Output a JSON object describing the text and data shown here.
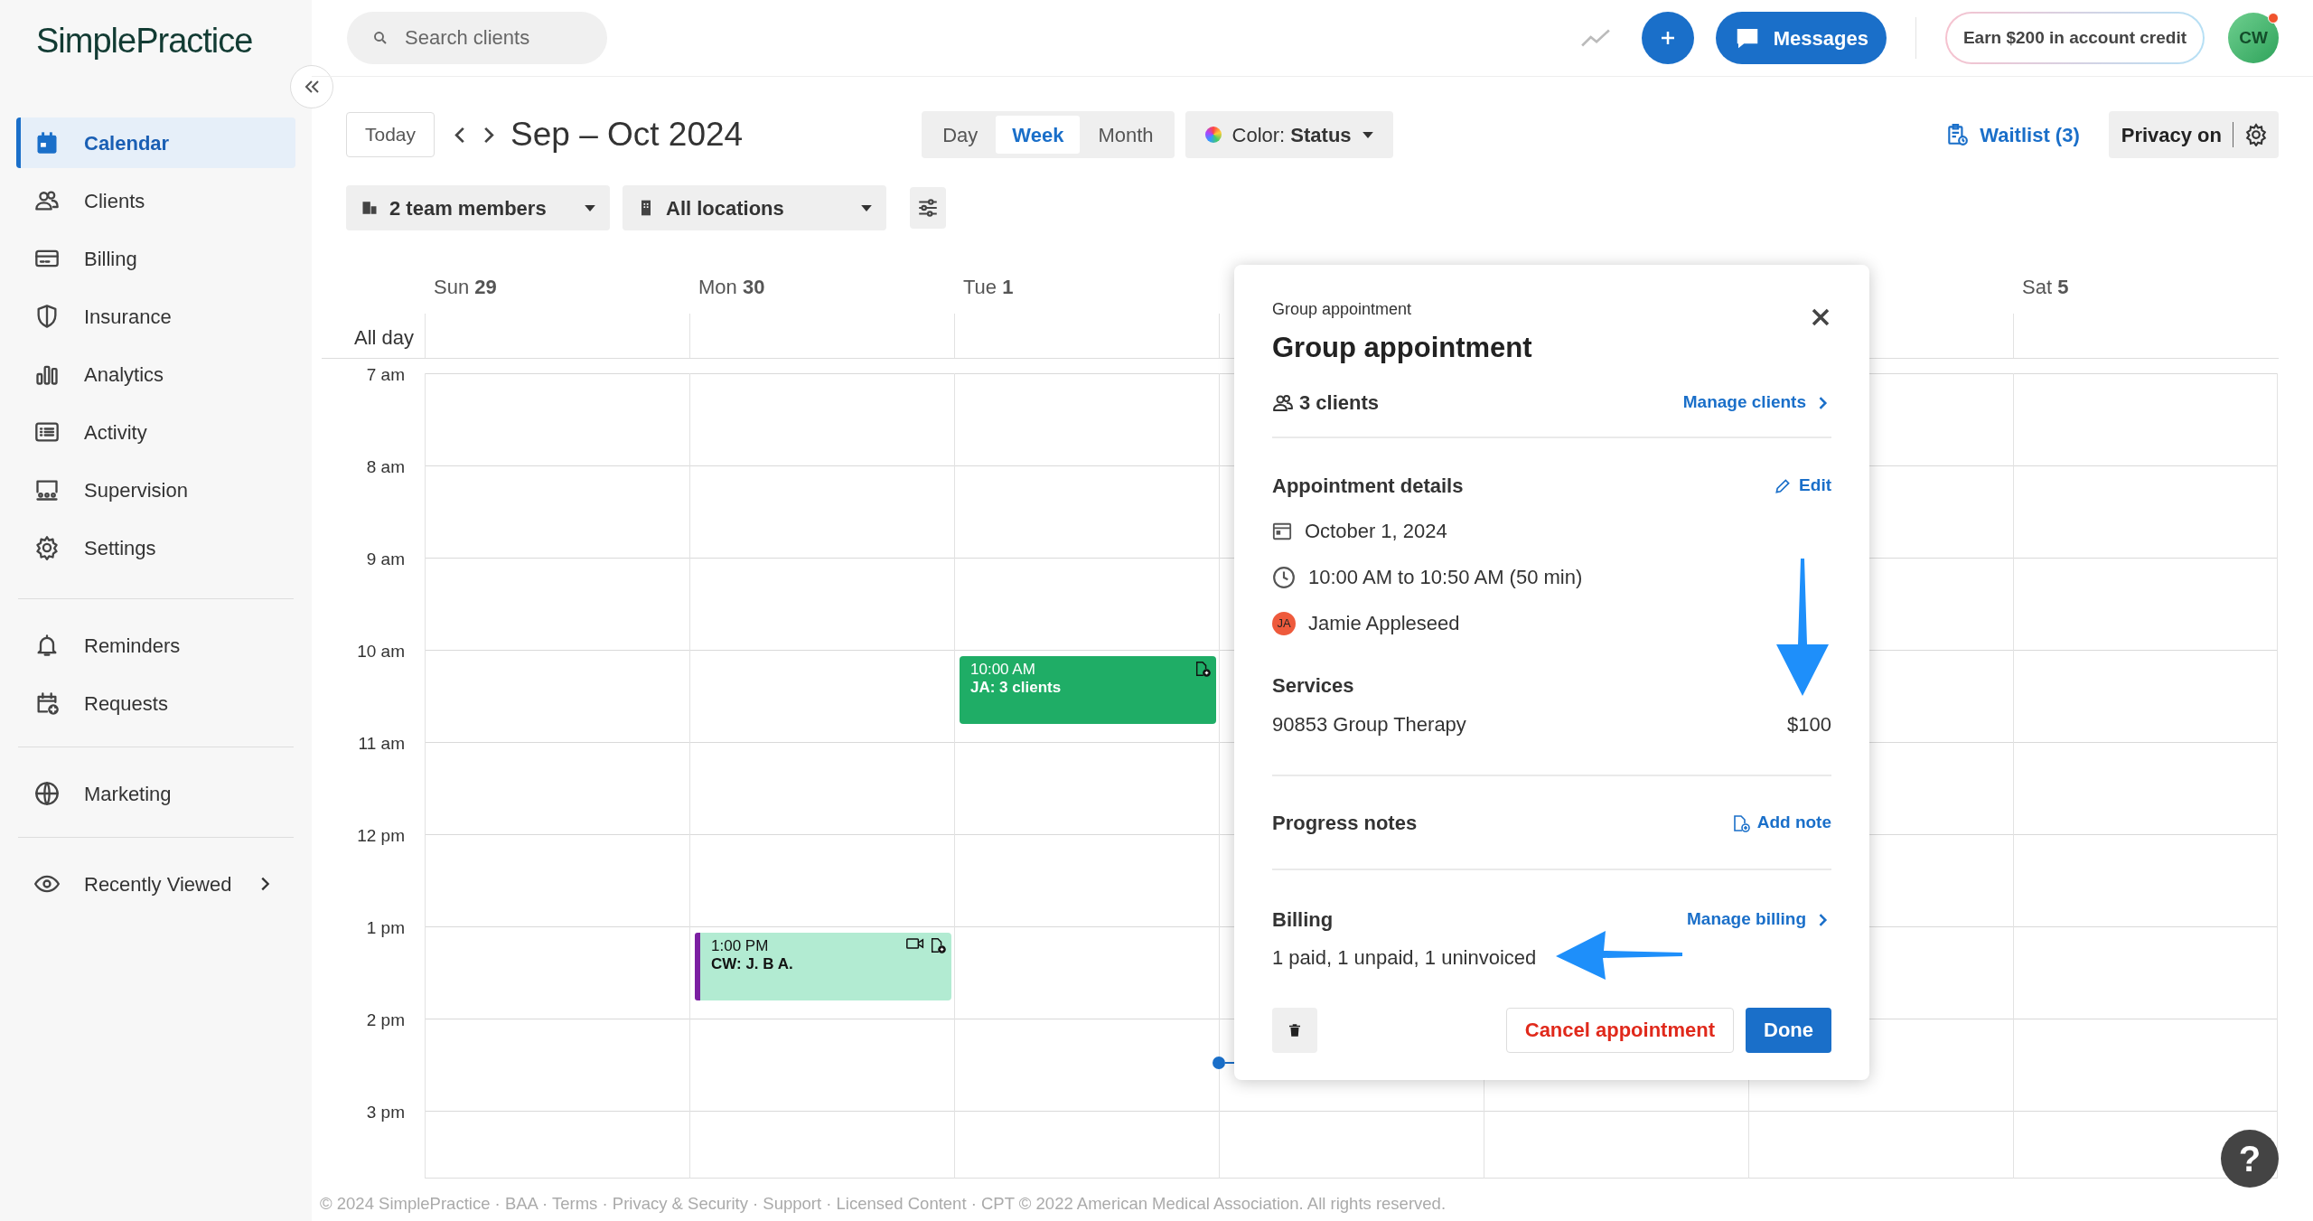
{
  "logo": {
    "text": "SimplePractice"
  },
  "sidebar": {
    "groups": [
      [
        {
          "label": "Calendar",
          "selected": true,
          "kind": "link"
        },
        {
          "label": "Clients",
          "selected": false,
          "kind": "link"
        },
        {
          "label": "Billing",
          "selected": false,
          "kind": "link"
        },
        {
          "label": "Insurance",
          "selected": false,
          "kind": "link"
        },
        {
          "label": "Analytics",
          "selected": false,
          "kind": "link"
        },
        {
          "label": "Activity",
          "selected": false,
          "kind": "link"
        },
        {
          "label": "Supervision",
          "selected": false,
          "kind": "link"
        },
        {
          "label": "Settings",
          "selected": false,
          "kind": "link"
        }
      ],
      [
        {
          "label": "Reminders",
          "selected": false,
          "kind": "link"
        },
        {
          "label": "Requests",
          "selected": false,
          "kind": "link"
        }
      ],
      [
        {
          "label": "Marketing",
          "selected": false,
          "kind": "link"
        }
      ],
      [
        {
          "label": "Recently Viewed",
          "selected": false,
          "kind": "submenu"
        }
      ]
    ]
  },
  "topbar": {
    "search": {
      "placeholder": "Search clients"
    },
    "messages_button": "Messages",
    "credit_button": "Earn $200 in account credit",
    "avatar": {
      "initials": "CW",
      "notification": true
    }
  },
  "toolbar": {
    "today": "Today",
    "range_title": "Sep – Oct 2024",
    "views": [
      {
        "label": "Day",
        "selected": false
      },
      {
        "label": "Week",
        "selected": true
      },
      {
        "label": "Month",
        "selected": false
      }
    ],
    "color_filter": {
      "label": "Color:",
      "value": "Status"
    },
    "waitlist": "Waitlist (3)",
    "privacy": "Privacy on"
  },
  "filters": [
    "2 team members",
    "All locations"
  ],
  "calendar": {
    "all_day_label": "All day",
    "hours": [
      "7 am",
      "8 am",
      "9 am",
      "10 am",
      "11 am",
      "12 pm",
      "1 pm",
      "2 pm",
      "3 pm"
    ],
    "days": [
      {
        "kind": "day",
        "weekday": "Sun",
        "date": "29"
      },
      {
        "kind": "day",
        "weekday": "Mon",
        "date": "30",
        "events": [
          {
            "time": "1:00 PM",
            "title": "CW: J. B A.",
            "kind": "individual",
            "color": "#b2ebd2",
            "video": true
          }
        ]
      },
      {
        "kind": "day",
        "weekday": "Tue",
        "date": "1",
        "events": [
          {
            "time": "10:00 AM",
            "title": "JA: 3 clients",
            "kind": "group",
            "color": "#1fad66",
            "video": false
          }
        ]
      },
      {
        "kind": "covered"
      },
      {
        "kind": "covered"
      },
      {
        "kind": "covered"
      },
      {
        "kind": "day",
        "weekday": "Sat",
        "date": "5"
      }
    ]
  },
  "popup": {
    "eyebrow": "Group appointment",
    "title": "Group appointment",
    "clients": "3 clients",
    "manage_clients": "Manage clients",
    "details_heading": "Appointment details",
    "edit": "Edit",
    "date": "October 1, 2024",
    "time": "10:00 AM to 10:50 AM (50 min)",
    "client": {
      "initials": "JA",
      "name": "Jamie Appleseed"
    },
    "services_heading": "Services",
    "services": [
      {
        "name": "90853 Group Therapy",
        "fee": "$100"
      }
    ],
    "notes_heading": "Progress notes",
    "add_note": "Add note",
    "billing_heading": "Billing",
    "manage_billing": "Manage billing",
    "billing_summary": "1 paid, 1 unpaid, 1 uninvoiced",
    "cancel": "Cancel appointment",
    "done": "Done"
  },
  "footer": "© 2024 SimplePractice · BAA · Terms · Privacy & Security · Support · Licensed Content · CPT © 2022 American Medical Association. All rights reserved.",
  "help": "?"
}
